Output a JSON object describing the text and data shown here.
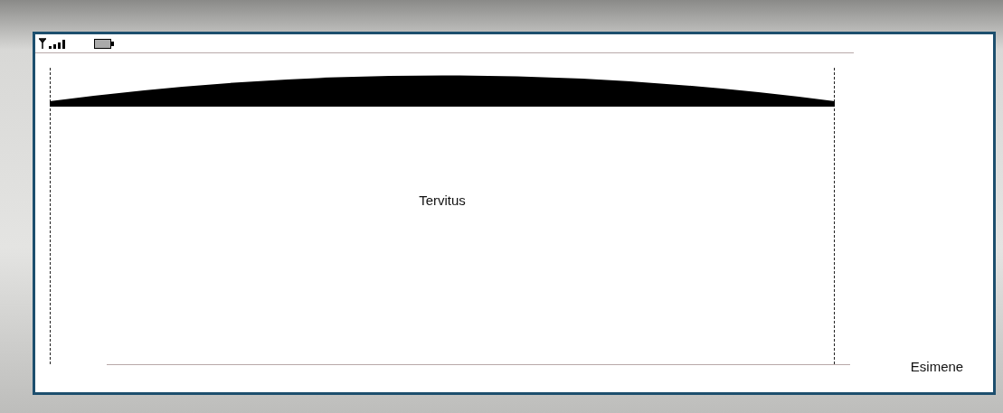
{
  "screen": {
    "message": "Tervitus"
  },
  "softkey": {
    "label": "Esimene"
  }
}
